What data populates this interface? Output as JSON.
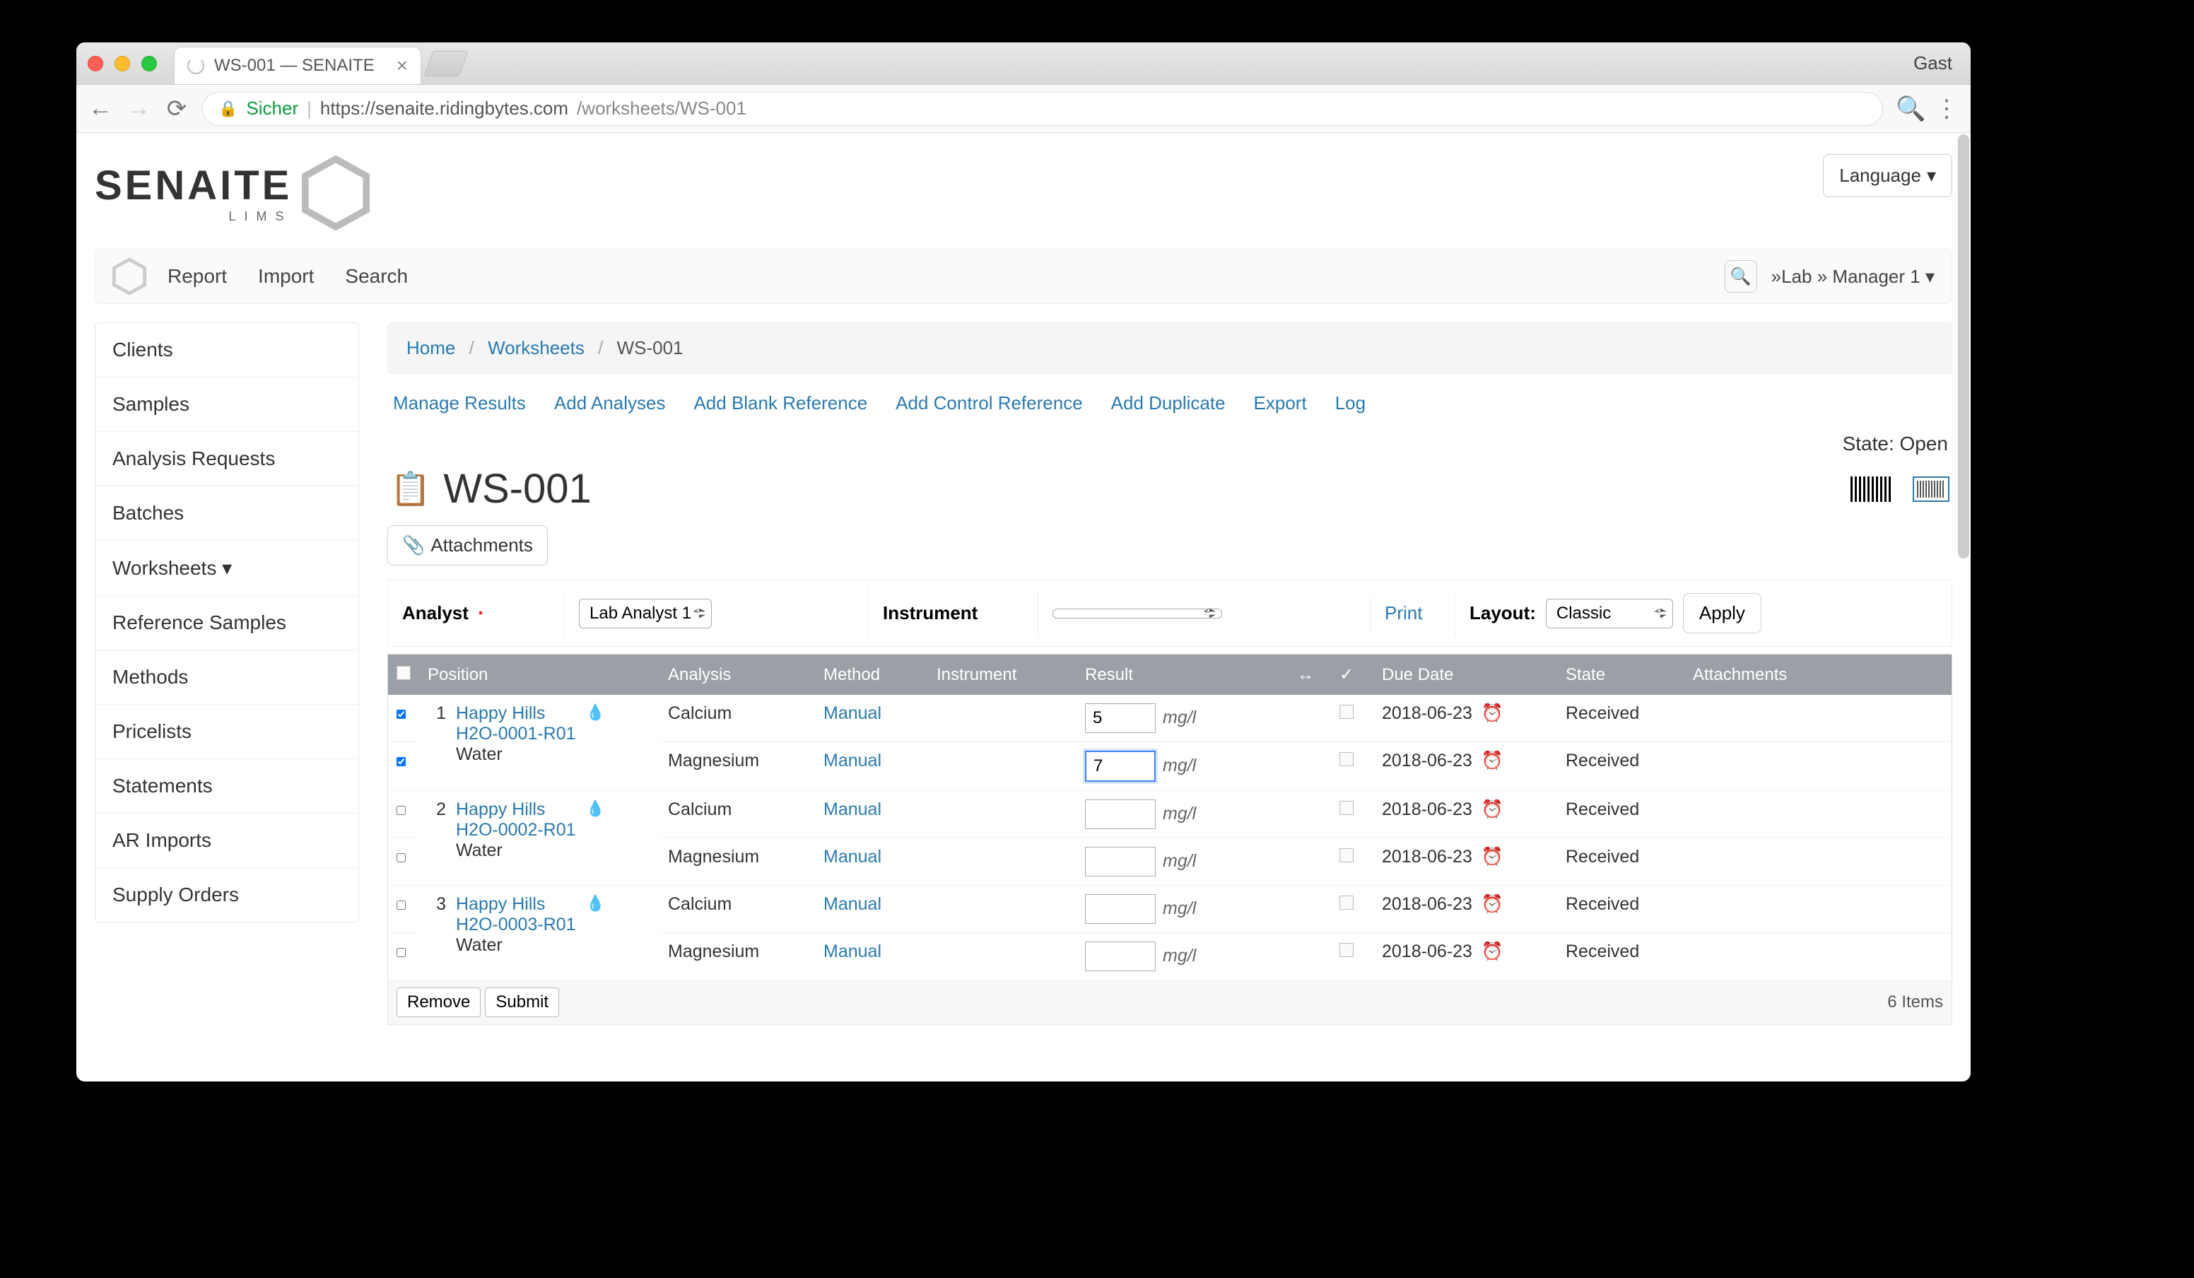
{
  "browser": {
    "tab_title": "WS-001 — SENAITE",
    "guest_label": "Gast",
    "secure_label": "Sicher",
    "url_host": "https://senaite.ridingbytes.com",
    "url_path": "/worksheets/WS-001"
  },
  "header": {
    "logo_text": "SENAITE",
    "logo_sub": "LIMS",
    "language_label": "Language"
  },
  "topnav": {
    "items": [
      "Report",
      "Import",
      "Search"
    ],
    "user": "»Lab » Manager 1"
  },
  "sidebar": {
    "items": [
      "Clients",
      "Samples",
      "Analysis Requests",
      "Batches",
      "Worksheets ▾",
      "Reference Samples",
      "Methods",
      "Pricelists",
      "Statements",
      "AR Imports",
      "Supply Orders"
    ]
  },
  "breadcrumb": {
    "home": "Home",
    "worksheets": "Worksheets",
    "current": "WS-001"
  },
  "actions": [
    "Manage Results",
    "Add Analyses",
    "Add Blank Reference",
    "Add Control Reference",
    "Add Duplicate",
    "Export",
    "Log"
  ],
  "state_label": "State: Open",
  "page_title": "WS-001",
  "attachments_btn": "Attachments",
  "controls": {
    "analyst_label": "Analyst",
    "analyst_value": "Lab Analyst 1",
    "instrument_label": "Instrument",
    "instrument_value": "",
    "print_label": "Print",
    "layout_label": "Layout:",
    "layout_value": "Classic",
    "apply_label": "Apply"
  },
  "table": {
    "headers": {
      "position": "Position",
      "analysis": "Analysis",
      "method": "Method",
      "instrument": "Instrument",
      "result": "Result",
      "due_date": "Due Date",
      "state": "State",
      "attachments": "Attachments"
    },
    "groups": [
      {
        "position": "1",
        "client": "Happy Hills",
        "ar": "H2O-0001-R01",
        "sample_type": "Water",
        "checked": true,
        "rows": [
          {
            "analysis": "Calcium",
            "method": "Manual",
            "result": "5",
            "unit": "mg/l",
            "due": "2018-06-23",
            "state": "Received",
            "checked": true,
            "focused": false
          },
          {
            "analysis": "Magnesium",
            "method": "Manual",
            "result": "7",
            "unit": "mg/l",
            "due": "2018-06-23",
            "state": "Received",
            "checked": true,
            "focused": true
          }
        ]
      },
      {
        "position": "2",
        "client": "Happy Hills",
        "ar": "H2O-0002-R01",
        "sample_type": "Water",
        "checked": false,
        "rows": [
          {
            "analysis": "Calcium",
            "method": "Manual",
            "result": "",
            "unit": "mg/l",
            "due": "2018-06-23",
            "state": "Received",
            "checked": false,
            "focused": false
          },
          {
            "analysis": "Magnesium",
            "method": "Manual",
            "result": "",
            "unit": "mg/l",
            "due": "2018-06-23",
            "state": "Received",
            "checked": false,
            "focused": false
          }
        ]
      },
      {
        "position": "3",
        "client": "Happy Hills",
        "ar": "H2O-0003-R01",
        "sample_type": "Water",
        "checked": false,
        "rows": [
          {
            "analysis": "Calcium",
            "method": "Manual",
            "result": "",
            "unit": "mg/l",
            "due": "2018-06-23",
            "state": "Received",
            "checked": false,
            "focused": false
          },
          {
            "analysis": "Magnesium",
            "method": "Manual",
            "result": "",
            "unit": "mg/l",
            "due": "2018-06-23",
            "state": "Received",
            "checked": false,
            "focused": false
          }
        ]
      }
    ],
    "remove_label": "Remove",
    "submit_label": "Submit",
    "items_count": "6 Items"
  }
}
